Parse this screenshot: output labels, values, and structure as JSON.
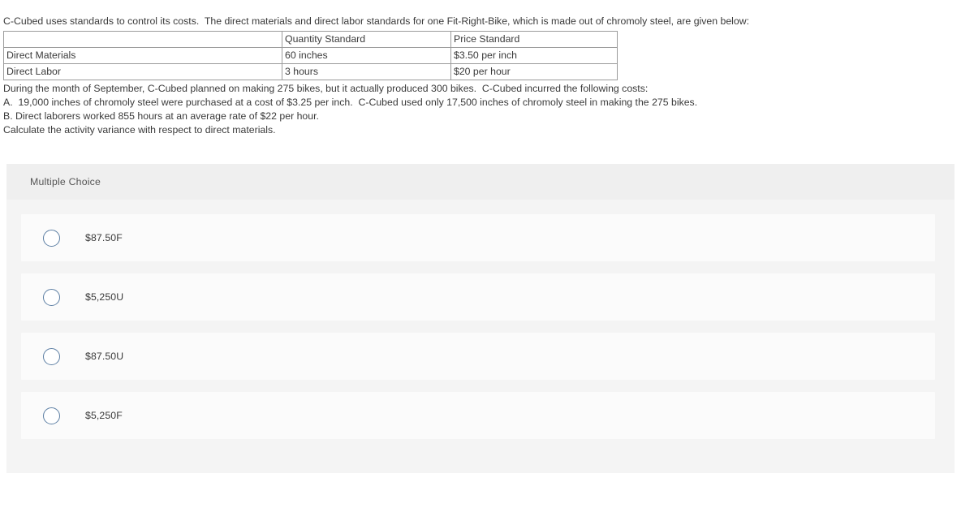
{
  "question": {
    "intro": "C-Cubed uses standards to control its costs.  The direct materials and direct labor standards for one Fit-Right-Bike, which is made out of chromoly steel, are given below:",
    "table": {
      "headers": [
        "",
        "Quantity Standard",
        "Price Standard"
      ],
      "rows": [
        [
          "Direct Materials",
          "60 inches",
          "$3.50 per inch"
        ],
        [
          "Direct Labor",
          "3 hours",
          "$20 per hour"
        ]
      ]
    },
    "body_lines": [
      "During the month of September, C-Cubed planned on making 275 bikes, but it actually produced 300 bikes.  C-Cubed incurred the following costs:",
      "A.  19,000 inches of chromoly steel were purchased at a cost of $3.25 per inch.  C-Cubed used only 17,500 inches of chromoly steel in making the 275 bikes.",
      "B. Direct laborers worked 855 hours at an average rate of $22 per hour.",
      "Calculate the activity variance with respect to direct materials."
    ]
  },
  "answer_panel": {
    "type_label": "Multiple Choice",
    "options": [
      {
        "id": "option-1",
        "label": "$87.50F",
        "selected": false
      },
      {
        "id": "option-2",
        "label": "$5,250U",
        "selected": false
      },
      {
        "id": "option-3",
        "label": "$87.50U",
        "selected": false
      },
      {
        "id": "option-4",
        "label": "$5,250F",
        "selected": false
      }
    ]
  },
  "colors": {
    "panel_background": "#f4f4f4",
    "panel_header_background": "#efefef",
    "option_card_background": "#fbfbfb",
    "radio_border": "#5d7fa4",
    "text": "#3a3a3a",
    "muted_text": "#555555",
    "table_border": "#9b9b9b"
  }
}
